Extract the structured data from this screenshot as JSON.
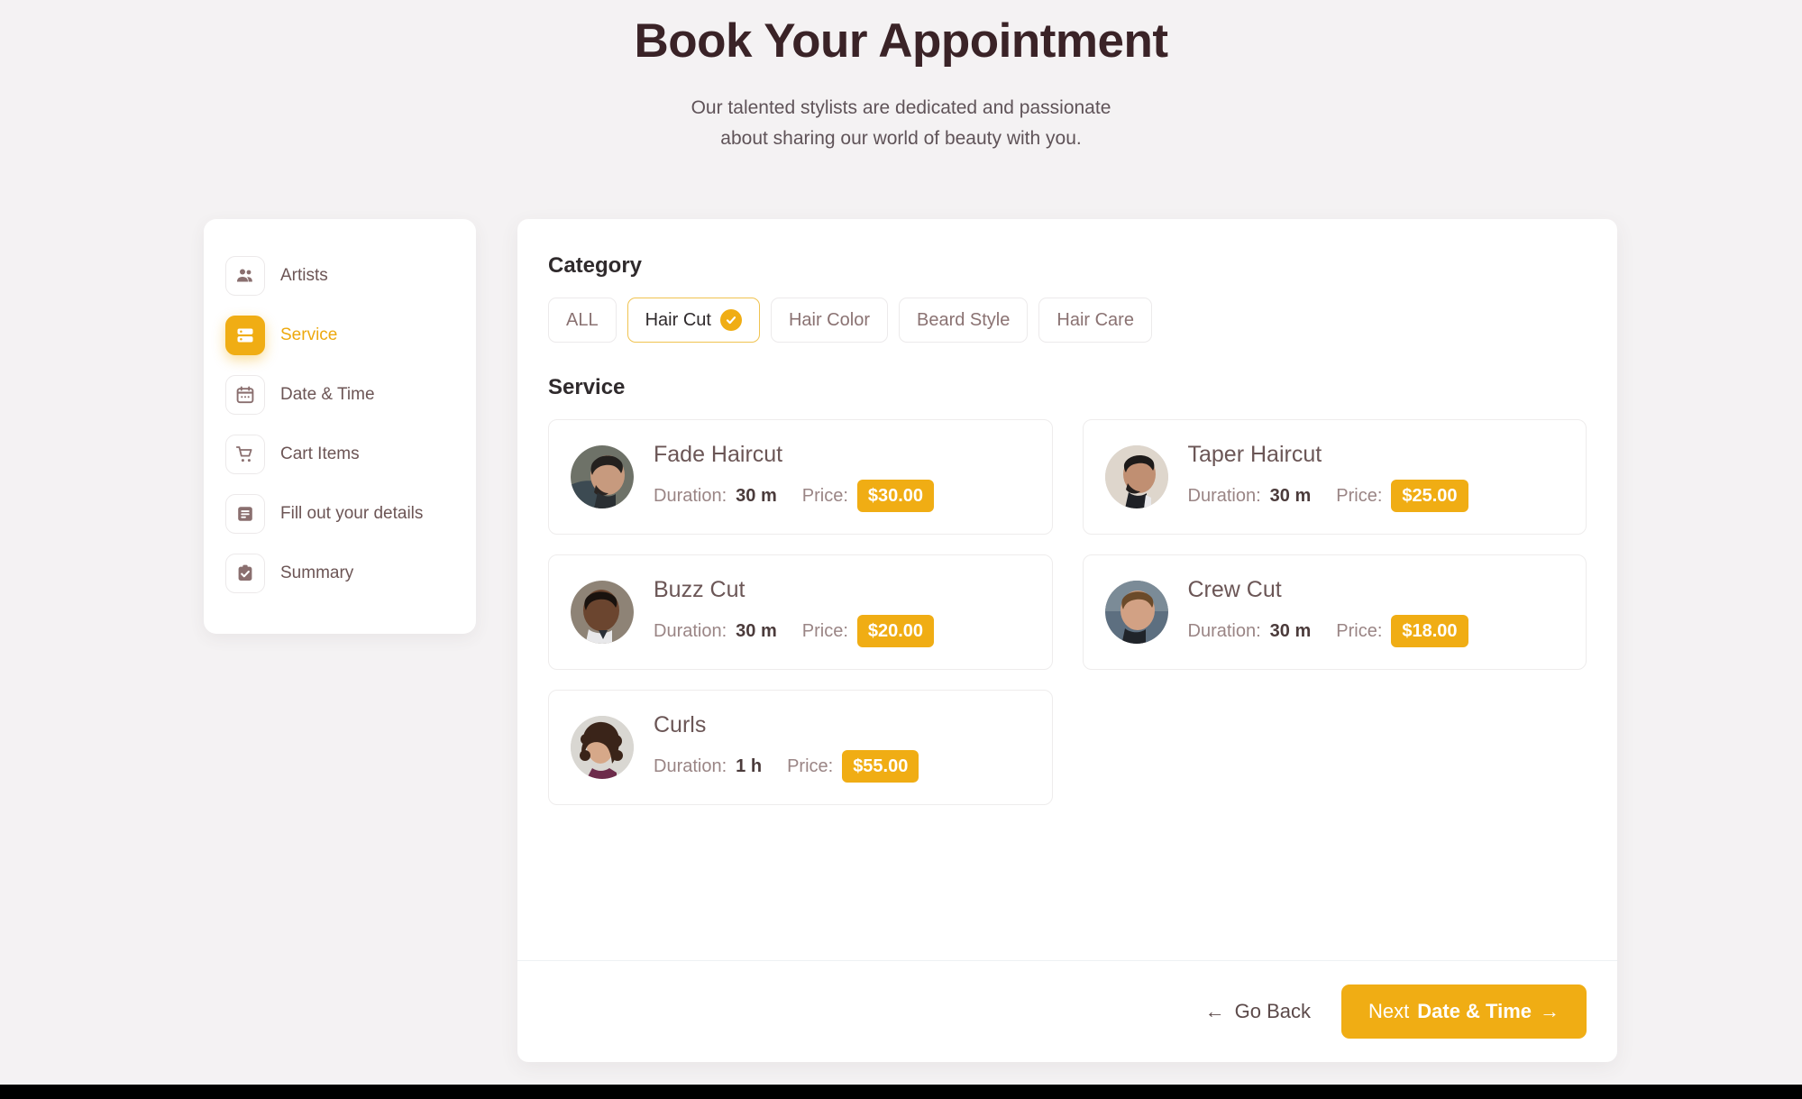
{
  "header": {
    "title": "Book Your Appointment",
    "subtitle_line1": "Our talented stylists are dedicated and passionate",
    "subtitle_line2": "about sharing our world of beauty with you."
  },
  "sidebar": {
    "items": [
      {
        "label": "Artists",
        "icon": "people-icon",
        "active": false
      },
      {
        "label": "Service",
        "icon": "service-list-icon",
        "active": true
      },
      {
        "label": "Date & Time",
        "icon": "calendar-icon",
        "active": false
      },
      {
        "label": "Cart Items",
        "icon": "cart-icon",
        "active": false
      },
      {
        "label": "Fill out your details",
        "icon": "form-icon",
        "active": false
      },
      {
        "label": "Summary",
        "icon": "clipboard-check-icon",
        "active": false
      }
    ]
  },
  "main": {
    "category_title": "Category",
    "categories": [
      {
        "label": "ALL",
        "selected": false
      },
      {
        "label": "Hair Cut",
        "selected": true
      },
      {
        "label": "Hair Color",
        "selected": false
      },
      {
        "label": "Beard Style",
        "selected": false
      },
      {
        "label": "Hair Care",
        "selected": false
      }
    ],
    "service_title": "Service",
    "duration_label": "Duration:",
    "price_label": "Price:",
    "services": [
      {
        "name": "Fade Haircut",
        "duration": "30 m",
        "price": "$30.00",
        "avatar": "man-fade-haircut"
      },
      {
        "name": "Taper Haircut",
        "duration": "30 m",
        "price": "$25.00",
        "avatar": "man-taper-haircut"
      },
      {
        "name": "Buzz Cut",
        "duration": "30 m",
        "price": "$20.00",
        "avatar": "man-buzz-cut"
      },
      {
        "name": "Crew Cut",
        "duration": "30 m",
        "price": "$18.00",
        "avatar": "man-crew-cut"
      },
      {
        "name": "Curls",
        "duration": "1 h",
        "price": "$55.00",
        "avatar": "woman-curls"
      }
    ]
  },
  "footer": {
    "back_label": "Go Back",
    "back_arrow": "←",
    "next_prefix": "Next",
    "next_target": "Date & Time",
    "next_arrow": "→"
  },
  "colors": {
    "accent": "#f0ad14",
    "page_background": "#f4f2f3",
    "panel": "#ffffff",
    "heading": "#3a2327",
    "muted_text": "#9a8585"
  }
}
